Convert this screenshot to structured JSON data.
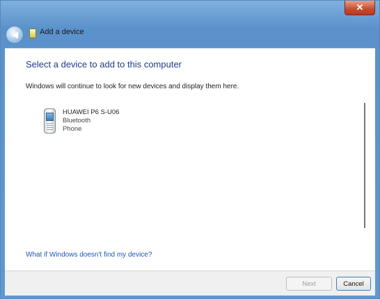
{
  "window": {
    "title": "Add a device",
    "close_label": "✕"
  },
  "main": {
    "heading": "Select a device to add to this computer",
    "description": "Windows will continue to look for new devices and display them here.",
    "devices": [
      {
        "name": "HUAWEI P6 S-U06",
        "connection": "Bluetooth",
        "category": "Phone",
        "icon": "phone-icon"
      }
    ],
    "help_link": "What if Windows doesn't find my device?"
  },
  "footer": {
    "next_label": "Next",
    "cancel_label": "Cancel"
  },
  "colors": {
    "heading": "#1e3b8a",
    "link": "#1e56b4",
    "titlebar": "#5f98d1",
    "close": "#c84a30"
  }
}
